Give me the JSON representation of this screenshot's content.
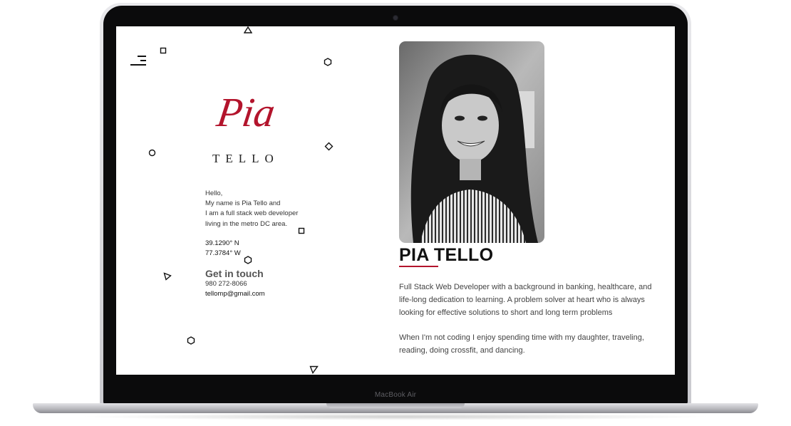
{
  "device": {
    "model_label": "MacBook Air"
  },
  "sidebar": {
    "menu_icon": "hamburger-menu-icon"
  },
  "logo": {
    "script_text": "Pia",
    "name_text": "TELLO",
    "accent_color": "#b3142c"
  },
  "intro": {
    "lines": [
      "Hello,",
      "My name is Pia Tello and",
      "I am a full stack web developer",
      "living in the metro DC area."
    ]
  },
  "location": {
    "latitude": "39.1290° N",
    "longitude": "77.3784° W"
  },
  "contact": {
    "title": "Get in touch",
    "phone": "980 272-8066",
    "email": "tellomp@gmail.com"
  },
  "profile": {
    "name": "PIA TELLO",
    "underline_color": "#b3142c",
    "bio_paragraph_1": "Full Stack Web Developer with a background in banking, healthcare, and life-long dedication to learning. A problem solver at heart who is always looking for effective solutions to short and long term problems",
    "bio_paragraph_2": "When I'm not coding I enjoy spending time with my daughter, traveling, reading, doing crossfit, and dancing.",
    "photo": "profile-photo (black and white portrait)"
  },
  "decorations": [
    "triangle-shape",
    "square-shape",
    "hexagon-shape",
    "circle-shape",
    "diamond-shape"
  ]
}
